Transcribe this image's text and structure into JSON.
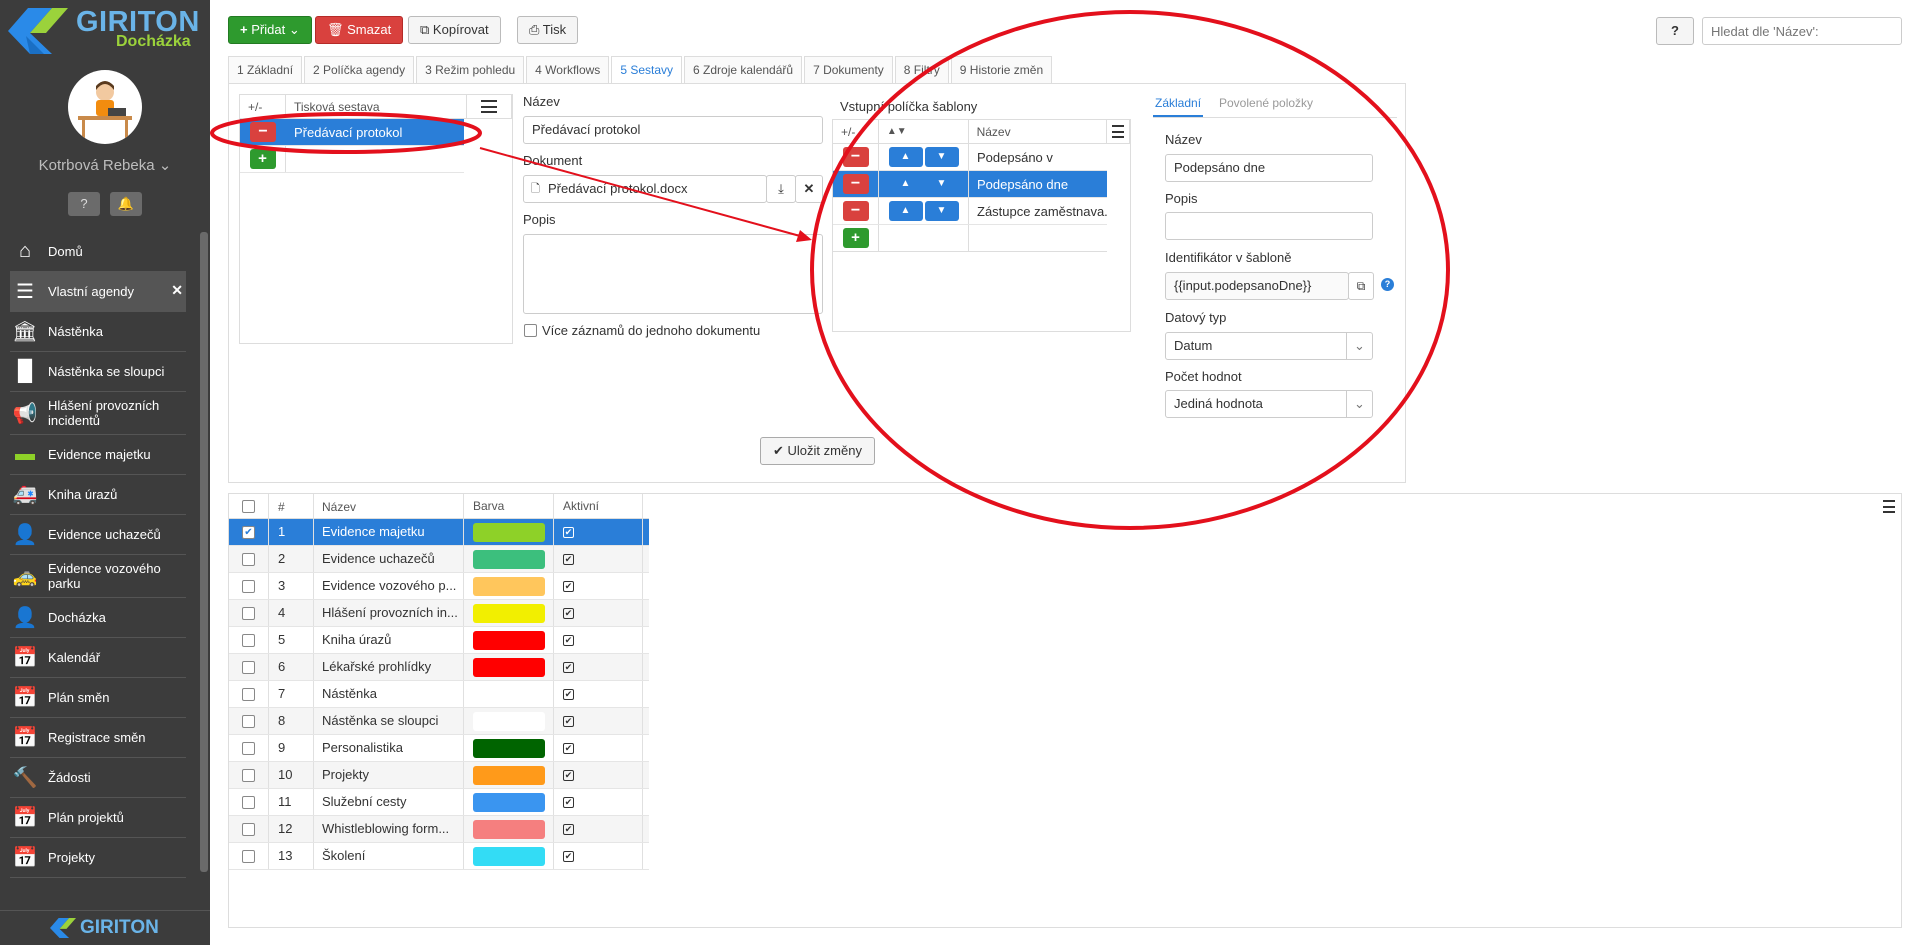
{
  "brand": {
    "name": "GIRITON",
    "module": "Docházka",
    "footer_name": "GIRITON"
  },
  "user": {
    "name": "Kotrbová Rebeka"
  },
  "sidebar_items": [
    {
      "label": "Domů",
      "icon": "home-icon",
      "color": "#ffffff"
    },
    {
      "label": "Vlastní agendy",
      "icon": "list-icon",
      "color": "#ffffff"
    },
    {
      "label": "Nástěnka",
      "icon": "bank-icon",
      "color": "#ffffff"
    },
    {
      "label": "Nástěnka se sloupci",
      "icon": "columns-icon",
      "color": "#ffffff"
    },
    {
      "label": "Hlášení provozních incidentů",
      "icon": "megaphone-icon",
      "color": "#e8e000"
    },
    {
      "label": "Evidence majetku",
      "icon": "box-icon",
      "color": "#8ed128"
    },
    {
      "label": "Kniha úrazů",
      "icon": "ambulance-icon",
      "color": "#e52521"
    },
    {
      "label": "Evidence uchazečů",
      "icon": "user-plus-icon",
      "color": "#3cbf7d"
    },
    {
      "label": "Evidence vozového parku",
      "icon": "car-icon",
      "color": "#f5b53c"
    },
    {
      "label": "Docházka",
      "icon": "person-icon",
      "color": "#2a8ae8"
    },
    {
      "label": "Kalendář",
      "icon": "calendar-icon",
      "color": "#2a8ae8"
    },
    {
      "label": "Plán směn",
      "icon": "calendar-grid-icon",
      "color": "#2a8ae8"
    },
    {
      "label": "Registrace směn",
      "icon": "calendar-check-icon",
      "color": "#2a8ae8"
    },
    {
      "label": "Žádosti",
      "icon": "gavel-icon",
      "color": "#2a8ae8"
    },
    {
      "label": "Plán projektů",
      "icon": "calendar-grid-icon",
      "color": "#f28c0f"
    },
    {
      "label": "Projekty",
      "icon": "calendar-icon",
      "color": "#f28c0f"
    }
  ],
  "toolbar": {
    "add": "Přidat",
    "delete": "Smazat",
    "copy": "Kopírovat",
    "print": "Tisk",
    "help": "?"
  },
  "search": {
    "placeholder": "Hledat dle 'Název':"
  },
  "tabs": [
    "1 Základní",
    "2 Políčka agendy",
    "3 Režim pohledu",
    "4 Workflows",
    "5 Sestavy",
    "6 Zdroje kalendářů",
    "7 Dokumenty",
    "8 Filtry",
    "9 Historie změn"
  ],
  "reports": {
    "col_pm": "+/-",
    "col_name": "Tisková sestava",
    "rows": [
      "Předávací protokol"
    ]
  },
  "report_form": {
    "name_label": "Název",
    "name_value": "Předávací protokol",
    "doc_label": "Dokument",
    "doc_value": "Předávací protokol.docx",
    "desc_label": "Popis",
    "multi_label": "Více záznamů do jednoho dokumentu",
    "save": "Uložit změny"
  },
  "fields": {
    "title": "Vstupní políčka šablony",
    "col_pm": "+/-",
    "col_sort": "▲▼",
    "col_name": "Název",
    "rows": [
      "Podepsáno v",
      "Podepsáno dne",
      "Zástupce zaměstnava..."
    ]
  },
  "detail": {
    "tab_basic": "Základní",
    "tab_allowed": "Povolené položky",
    "name_label": "Název",
    "name_value": "Podepsáno dne",
    "desc_label": "Popis",
    "id_label": "Identifikátor v šabloně",
    "id_value": "{{input.podepsanoDne}}",
    "type_label": "Datový typ",
    "type_value": "Datum",
    "count_label": "Počet hodnot",
    "count_value": "Jediná hodnota"
  },
  "agendas": {
    "columns": [
      "#",
      "Název",
      "Barva",
      "Aktivní"
    ],
    "rows": [
      {
        "num": "1",
        "name": "Evidence majetku",
        "color": "#8ed128",
        "active": true
      },
      {
        "num": "2",
        "name": "Evidence uchazečů",
        "color": "#3cbf7d",
        "active": true
      },
      {
        "num": "3",
        "name": "Evidence vozového p...",
        "color": "#ffc65c",
        "active": true
      },
      {
        "num": "4",
        "name": "Hlášení provozních in...",
        "color": "#f2ef00",
        "active": true
      },
      {
        "num": "5",
        "name": "Kniha úrazů",
        "color": "#ff0000",
        "active": true
      },
      {
        "num": "6",
        "name": "Lékařské prohlídky",
        "color": "#ff0000",
        "active": true
      },
      {
        "num": "7",
        "name": "Nástěnka",
        "color": "#ffffff",
        "active": true
      },
      {
        "num": "8",
        "name": "Nástěnka se sloupci",
        "color": "#ffffff",
        "active": true
      },
      {
        "num": "9",
        "name": "Personalistika",
        "color": "#006400",
        "active": true
      },
      {
        "num": "10",
        "name": "Projekty",
        "color": "#ff9a1a",
        "active": true
      },
      {
        "num": "11",
        "name": "Služební cesty",
        "color": "#3a95f0",
        "active": true
      },
      {
        "num": "12",
        "name": "Whistleblowing form...",
        "color": "#f57f7f",
        "active": true
      },
      {
        "num": "13",
        "name": "Školení",
        "color": "#33dcf5",
        "active": true
      }
    ]
  },
  "colors": {
    "accent": "#2a7ed8",
    "sidebar": "#3c3c3c",
    "annotation": "#e3101c"
  }
}
